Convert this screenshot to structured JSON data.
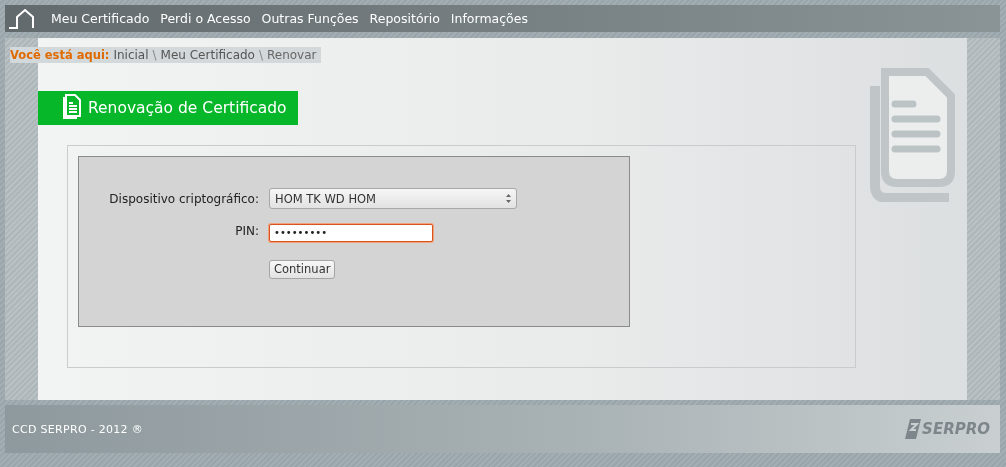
{
  "nav": {
    "items": [
      {
        "label": "Meu Certificado"
      },
      {
        "label": "Perdi o Acesso"
      },
      {
        "label": "Outras Funções"
      },
      {
        "label": "Repositório"
      },
      {
        "label": "Informações"
      }
    ]
  },
  "breadcrumb": {
    "prefix": "Você está aqui:",
    "items": [
      {
        "kind": "link",
        "label": "Inicial"
      },
      {
        "kind": "separator",
        "label": "\\"
      },
      {
        "kind": "link",
        "label": "Meu Certificado"
      },
      {
        "kind": "separator",
        "label": "\\"
      },
      {
        "kind": "current",
        "label": "Renovar"
      }
    ]
  },
  "section_title": "Renovação de Certificado",
  "form": {
    "device_label": "Dispositivo criptográfico:",
    "device_value": "HOM TK WD HOM",
    "pin_label": "PIN:",
    "pin_value": "•••••••••",
    "pin_focused": true,
    "submit": "Continuar"
  },
  "footer": {
    "copyright": "CCD SERPRO - 2012 ®",
    "logo_text": "SERPRO"
  }
}
